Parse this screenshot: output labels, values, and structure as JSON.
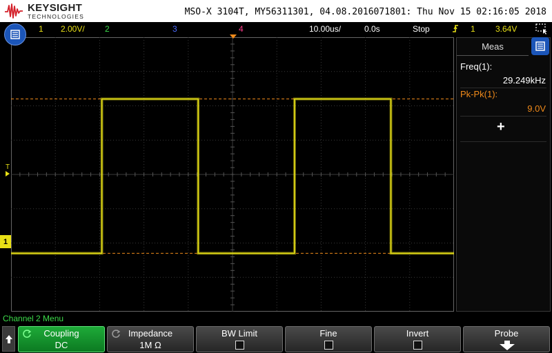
{
  "header": {
    "brand": "KEYSIGHT",
    "brand_sub": "TECHNOLOGIES",
    "instrument_info": "MSO-X 3104T, MY56311301, 04.08.2016071801: Thu Nov 15 02:16:05 2018"
  },
  "status": {
    "ch1_number": "1",
    "ch1_scale": "2.00V/",
    "ch2_number": "2",
    "ch3_number": "3",
    "ch4_number": "4",
    "timebase": "10.00us/",
    "delay": "0.0s",
    "run_state": "Stop",
    "trigger_source": "1",
    "trigger_level": "3.64V",
    "colors": {
      "ch1": "#e8e016",
      "ch2": "#3cdc4a",
      "ch3": "#4a6cff",
      "ch4": "#ff3c8c",
      "trigger": "#f08a1a"
    }
  },
  "screen": {
    "channel_marker": "1",
    "trigger_marker": "T",
    "waveform": {
      "channel": "1",
      "type": "square",
      "high_divisions_from_center": 2.2,
      "low_divisions_from_center": -2.3,
      "period_divisions": 4.35,
      "first_rise_division": 2.05,
      "cursor_upper_divisions": 2.2,
      "cursor_lower_divisions": -2.3
    }
  },
  "measurements": {
    "tab_label": "Meas",
    "items": [
      {
        "label": "Freq(1):",
        "value": "29.249kHz",
        "color": "#ffffff"
      },
      {
        "label": "Pk-Pk(1):",
        "value": "9.0V",
        "color": "#f08a1a"
      }
    ],
    "add_label": "+"
  },
  "menu": {
    "title": "Channel 2 Menu",
    "softkeys": [
      {
        "label": "Coupling",
        "value": "DC",
        "active": true,
        "control": "knob"
      },
      {
        "label": "Impedance",
        "value": "1M Ω",
        "active": false,
        "control": "knob"
      },
      {
        "label": "BW Limit",
        "value": "",
        "active": false,
        "control": "checkbox"
      },
      {
        "label": "Fine",
        "value": "",
        "active": false,
        "control": "checkbox"
      },
      {
        "label": "Invert",
        "value": "",
        "active": false,
        "control": "checkbox"
      },
      {
        "label": "Probe",
        "value": "",
        "active": false,
        "control": "submenu"
      }
    ]
  }
}
